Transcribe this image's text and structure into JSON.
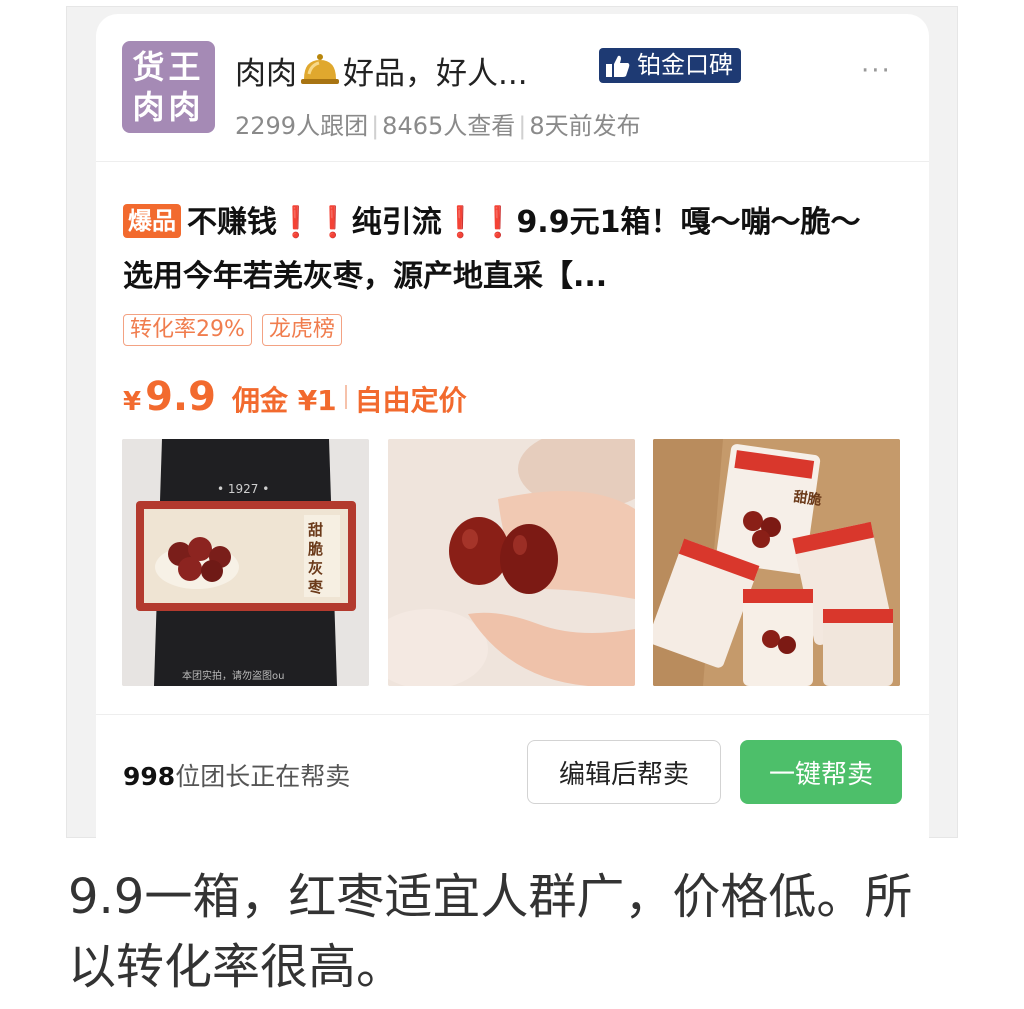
{
  "shop": {
    "avatar_line1": "货王",
    "avatar_line2": "肉肉",
    "name_part1": "肉肉",
    "name_part2": "好品，好人...",
    "badge_label": "铂金口碑",
    "more": "···"
  },
  "stats": {
    "followers": "2299人跟团",
    "views": "8465人查看",
    "posted": "8天前发布"
  },
  "product": {
    "hot_tag": "爆品",
    "title_1": "不赚钱",
    "title_excl": "❗❗",
    "title_2": "纯引流",
    "title_3": "9.9元1箱！嘎～嘣～脆～选用今年若羌灰枣，源产地直采【...",
    "tags": [
      "转化率29%",
      "龙虎榜"
    ],
    "price_symbol": "¥",
    "price": "9.9",
    "commission": "佣金 ¥1",
    "pricing": "自由定价"
  },
  "photos": [
    "product-box-photo",
    "date-in-hand-photo",
    "shipping-box-photo"
  ],
  "footer": {
    "seller_count": "998",
    "seller_text": "位团长正在帮卖",
    "edit_button": "编辑后帮卖",
    "sell_button": "一键帮卖"
  },
  "caption": "9.9一箱，红枣适宜人群广，价格低。所以转化率很高。",
  "colors": {
    "accent_orange": "#f26a2e",
    "button_green": "#4dbf6a",
    "badge_navy": "#1e3a73",
    "avatar_purple": "#a58ab5"
  }
}
